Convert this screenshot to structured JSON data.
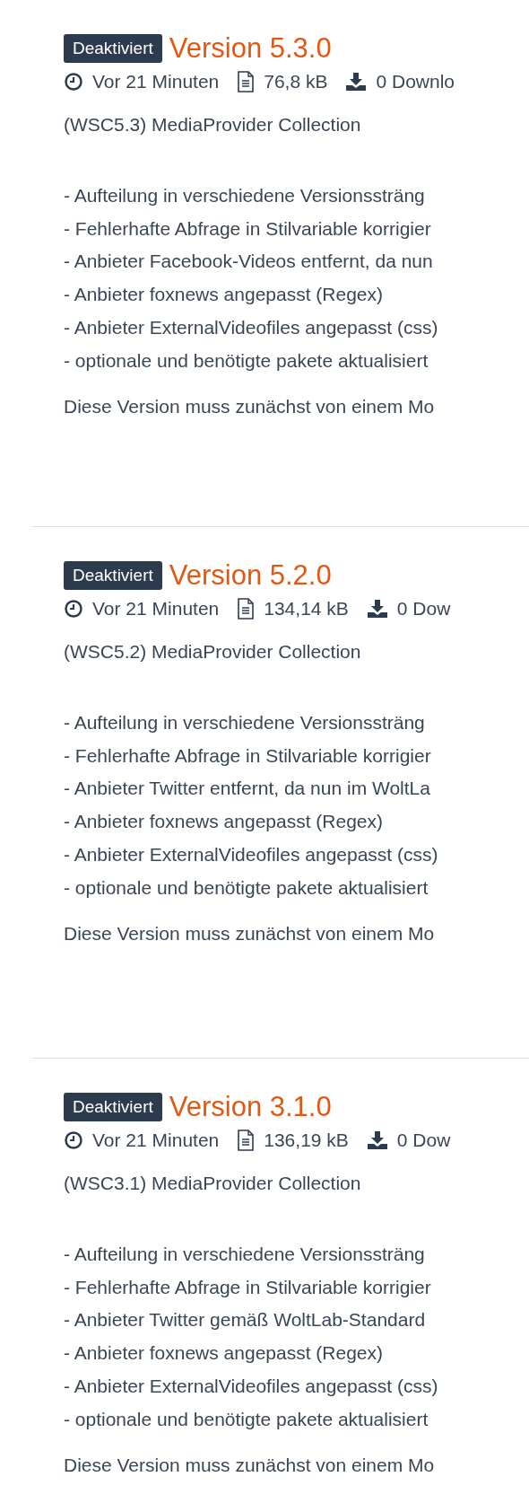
{
  "versions": [
    {
      "badge": "Deaktiviert",
      "title": "Version 5.3.0",
      "meta": [
        {
          "kind": "time",
          "text": "Vor 21 Minuten"
        },
        {
          "kind": "size",
          "text": "76,8 kB"
        },
        {
          "kind": "downloads",
          "text": "0 Downlo"
        }
      ],
      "description": "(WSC5.3) MediaProvider Collection",
      "changes": [
        "- Aufteilung in verschiedene Versionssträng",
        "- Fehlerhafte Abfrage in Stilvariable korrigier",
        "- Anbieter Facebook-Videos entfernt, da nun",
        "- Anbieter foxnews angepasst (Regex)",
        "- Anbieter ExternalVideofiles angepasst (css)",
        "- optionale und benötigte pakete aktualisiert"
      ],
      "note": "Diese Version muss zunächst von einem Mo"
    },
    {
      "badge": "Deaktiviert",
      "title": "Version 5.2.0",
      "meta": [
        {
          "kind": "time",
          "text": "Vor 21 Minuten"
        },
        {
          "kind": "size",
          "text": "134,14 kB"
        },
        {
          "kind": "downloads",
          "text": "0 Dow"
        }
      ],
      "description": "(WSC5.2) MediaProvider Collection",
      "changes": [
        "- Aufteilung in verschiedene Versionssträng",
        "- Fehlerhafte Abfrage in Stilvariable korrigier",
        "- Anbieter Twitter entfernt, da nun im WoltLa",
        "- Anbieter foxnews angepasst (Regex)",
        "- Anbieter ExternalVideofiles angepasst (css)",
        "- optionale und benötigte pakete aktualisiert"
      ],
      "note": "Diese Version muss zunächst von einem Mo"
    },
    {
      "badge": "Deaktiviert",
      "title": "Version 3.1.0",
      "meta": [
        {
          "kind": "time",
          "text": "Vor 21 Minuten"
        },
        {
          "kind": "size",
          "text": "136,19 kB"
        },
        {
          "kind": "downloads",
          "text": "0 Dow"
        }
      ],
      "description": "(WSC3.1) MediaProvider Collection",
      "changes": [
        "- Aufteilung in verschiedene Versionssträng",
        "- Fehlerhafte Abfrage in Stilvariable korrigier",
        "- Anbieter Twitter gemäß WoltLab-Standard",
        "- Anbieter foxnews angepasst (Regex)",
        "- Anbieter ExternalVideofiles angepasst (css)",
        "- optionale und benötigte pakete aktualisiert"
      ],
      "note": "Diese Version muss zunächst von einem Mo"
    }
  ]
}
